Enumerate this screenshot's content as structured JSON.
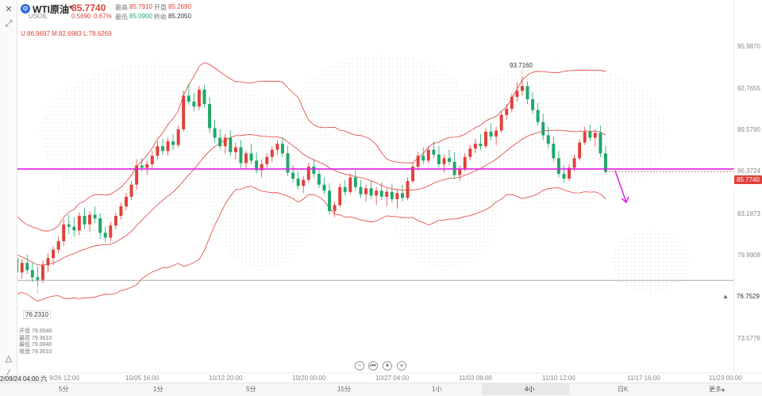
{
  "header": {
    "logo_letter": "◉",
    "symbol": "WTI原油",
    "ticker": "USOIL",
    "price": "85.7740",
    "change": "0.5690",
    "change_pct": "0.67%",
    "high_label": "最高",
    "high": "85.7910",
    "open_label": "开盘",
    "open": "85.2690",
    "low_label": "最低",
    "low": "85.0900",
    "prev_label": "昨收",
    "prev": "85.2050",
    "bollinger": "U:86.9697  M:82.6983  L:78.6269"
  },
  "colors": {
    "up": "#e0413a",
    "down": "#1fa76a",
    "band": "#e0413a",
    "hline": "#e020e0",
    "arrow": "#e020e0"
  },
  "y_axis": {
    "ticks": [
      "95.9870",
      "92.7655",
      "89.5790",
      "86.3724",
      "83.1873",
      "79.9908",
      "73.5776"
    ]
  },
  "price_tags": {
    "current": "85.7740",
    "low_line": "76.7529"
  },
  "annotations": {
    "peak": "93.7160",
    "trough": "76.2310"
  },
  "crosshair_info": {
    "lines": [
      "开盘 79.0040",
      "最高 79.3610",
      "最低 79.0040",
      "收盘 79.3010"
    ]
  },
  "x_axis": {
    "cursor": "2/09/24 04:00 六",
    "labels": [
      "9/26 12:00",
      "10/05 16:00",
      "10/12 20:00",
      "10/20 00:00",
      "10/27 04:00",
      "11/03 08:00",
      "11/10 12:00",
      "11/17 16:00",
      "11/23 00:00"
    ]
  },
  "timeframes": [
    "5分",
    "1分",
    "5分",
    "15分",
    "1小时",
    "4小时",
    "日K",
    "更多"
  ],
  "timeframes_display": [
    "5分",
    "1分",
    "5分",
    "15分",
    "1小",
    "4小",
    "日K",
    "更多▴"
  ],
  "chart_data": {
    "type": "candlestick",
    "title": "WTI原油",
    "ylim": [
      70.5,
      98.2
    ],
    "candles": [
      [
        79.5,
        81.2,
        78.8,
        80.6
      ],
      [
        80.6,
        81.0,
        78.0,
        78.6
      ],
      [
        78.6,
        79.3,
        77.0,
        77.4
      ],
      [
        77.4,
        78.5,
        76.9,
        78.2
      ],
      [
        78.2,
        78.9,
        77.3,
        77.6
      ],
      [
        77.6,
        78.3,
        76.6,
        77.0
      ],
      [
        77.0,
        77.9,
        76.2,
        76.8
      ],
      [
        76.8,
        78.4,
        76.5,
        78.0
      ],
      [
        78.0,
        79.0,
        77.4,
        78.6
      ],
      [
        78.6,
        79.6,
        78.0,
        79.3
      ],
      [
        79.3,
        80.4,
        79.0,
        80.0
      ],
      [
        80.0,
        81.8,
        79.6,
        81.4
      ],
      [
        81.4,
        82.2,
        80.6,
        81.2
      ],
      [
        81.2,
        82.0,
        80.4,
        80.9
      ],
      [
        80.9,
        82.4,
        80.5,
        82.1
      ],
      [
        82.1,
        82.8,
        81.0,
        81.4
      ],
      [
        81.4,
        82.5,
        80.8,
        82.2
      ],
      [
        82.2,
        82.9,
        81.5,
        81.9
      ],
      [
        81.9,
        82.3,
        80.2,
        80.7
      ],
      [
        80.7,
        81.2,
        79.9,
        80.3
      ],
      [
        80.3,
        81.6,
        80.0,
        81.3
      ],
      [
        81.3,
        82.4,
        81.0,
        82.1
      ],
      [
        82.1,
        83.2,
        81.8,
        82.9
      ],
      [
        82.9,
        84.0,
        82.6,
        83.7
      ],
      [
        83.7,
        85.0,
        83.4,
        84.7
      ],
      [
        84.7,
        86.8,
        84.3,
        86.3
      ],
      [
        86.3,
        86.9,
        85.8,
        86.1
      ],
      [
        86.1,
        86.7,
        85.5,
        86.4
      ],
      [
        86.4,
        87.5,
        86.0,
        87.1
      ],
      [
        87.1,
        88.3,
        86.8,
        87.9
      ],
      [
        87.9,
        88.5,
        87.2,
        87.5
      ],
      [
        87.5,
        88.6,
        87.1,
        88.3
      ],
      [
        88.3,
        88.9,
        87.6,
        88.0
      ],
      [
        88.0,
        89.6,
        87.8,
        89.3
      ],
      [
        89.3,
        92.5,
        89.1,
        92.1
      ],
      [
        92.1,
        93.1,
        91.3,
        91.6
      ],
      [
        91.6,
        92.3,
        90.8,
        91.2
      ],
      [
        91.2,
        92.9,
        90.9,
        92.6
      ],
      [
        92.6,
        93.0,
        91.1,
        91.4
      ],
      [
        91.4,
        92.0,
        89.0,
        89.4
      ],
      [
        89.4,
        90.1,
        88.2,
        88.6
      ],
      [
        88.6,
        89.3,
        87.6,
        87.9
      ],
      [
        87.9,
        88.9,
        87.3,
        88.6
      ],
      [
        88.6,
        89.2,
        87.1,
        87.4
      ],
      [
        87.4,
        88.2,
        86.8,
        87.8
      ],
      [
        87.8,
        88.4,
        86.1,
        86.5
      ],
      [
        86.5,
        87.5,
        86.0,
        87.3
      ],
      [
        87.3,
        88.1,
        86.4,
        86.7
      ],
      [
        86.7,
        87.4,
        85.6,
        85.9
      ],
      [
        85.9,
        86.8,
        85.3,
        86.4
      ],
      [
        86.4,
        87.3,
        86.1,
        87.0
      ],
      [
        87.0,
        87.9,
        86.6,
        87.6
      ],
      [
        87.6,
        88.4,
        87.2,
        88.1
      ],
      [
        88.1,
        88.6,
        87.0,
        87.3
      ],
      [
        87.3,
        87.9,
        85.4,
        85.7
      ],
      [
        85.7,
        86.3,
        84.9,
        85.2
      ],
      [
        85.2,
        85.8,
        84.3,
        84.6
      ],
      [
        84.6,
        85.4,
        84.0,
        85.1
      ],
      [
        85.1,
        86.5,
        84.9,
        86.2
      ],
      [
        86.2,
        86.8,
        85.3,
        85.6
      ],
      [
        85.6,
        86.0,
        84.4,
        84.7
      ],
      [
        84.7,
        85.3,
        83.9,
        84.2
      ],
      [
        84.2,
        84.8,
        82.2,
        82.5
      ],
      [
        82.5,
        83.3,
        82.0,
        83.0
      ],
      [
        83.0,
        84.8,
        82.8,
        84.5
      ],
      [
        84.5,
        85.1,
        83.8,
        84.1
      ],
      [
        84.1,
        85.6,
        83.9,
        85.3
      ],
      [
        85.3,
        85.9,
        84.2,
        84.5
      ],
      [
        84.5,
        85.1,
        83.6,
        83.9
      ],
      [
        83.9,
        84.7,
        83.3,
        84.4
      ],
      [
        84.4,
        85.0,
        83.5,
        83.8
      ],
      [
        83.8,
        84.5,
        83.0,
        84.2
      ],
      [
        84.2,
        84.9,
        83.4,
        83.7
      ],
      [
        83.7,
        84.4,
        82.9,
        84.1
      ],
      [
        84.1,
        84.8,
        83.2,
        83.5
      ],
      [
        83.5,
        84.3,
        82.7,
        84.0
      ],
      [
        84.0,
        84.7,
        83.3,
        83.6
      ],
      [
        83.6,
        85.3,
        83.4,
        85.0
      ],
      [
        85.0,
        86.5,
        84.8,
        86.2
      ],
      [
        86.2,
        87.4,
        85.9,
        87.1
      ],
      [
        87.1,
        87.8,
        86.4,
        86.7
      ],
      [
        86.7,
        87.9,
        86.5,
        87.6
      ],
      [
        87.6,
        88.3,
        86.9,
        87.2
      ],
      [
        87.2,
        87.9,
        86.1,
        86.4
      ],
      [
        86.4,
        87.2,
        85.7,
        86.9
      ],
      [
        86.9,
        87.6,
        86.3,
        86.6
      ],
      [
        86.6,
        87.4,
        85.2,
        85.5
      ],
      [
        85.5,
        86.3,
        85.0,
        86.0
      ],
      [
        86.0,
        87.3,
        85.8,
        87.0
      ],
      [
        87.0,
        88.0,
        86.7,
        87.7
      ],
      [
        87.7,
        88.5,
        87.3,
        88.1
      ],
      [
        88.1,
        88.9,
        87.6,
        87.9
      ],
      [
        87.9,
        89.4,
        87.7,
        89.1
      ],
      [
        89.1,
        89.8,
        88.4,
        88.7
      ],
      [
        88.7,
        89.5,
        88.0,
        89.2
      ],
      [
        89.2,
        90.8,
        89.0,
        90.5
      ],
      [
        90.5,
        91.4,
        90.1,
        91.0
      ],
      [
        91.0,
        92.3,
        90.7,
        92.0
      ],
      [
        92.0,
        93.2,
        91.6,
        92.5
      ],
      [
        92.5,
        93.7,
        92.1,
        92.9
      ],
      [
        92.9,
        93.3,
        91.4,
        91.8
      ],
      [
        91.8,
        92.4,
        90.6,
        90.9
      ],
      [
        90.9,
        91.5,
        89.6,
        89.9
      ],
      [
        89.9,
        90.6,
        88.4,
        88.8
      ],
      [
        88.8,
        89.5,
        87.7,
        88.1
      ],
      [
        88.1,
        88.7,
        86.6,
        86.9
      ],
      [
        86.9,
        87.5,
        85.3,
        85.6
      ],
      [
        85.6,
        86.3,
        84.9,
        85.2
      ],
      [
        85.2,
        86.4,
        85.0,
        86.1
      ],
      [
        86.1,
        87.2,
        85.8,
        86.9
      ],
      [
        86.9,
        88.5,
        86.7,
        88.2
      ],
      [
        88.2,
        89.5,
        88.0,
        89.1
      ],
      [
        89.1,
        89.7,
        88.3,
        88.6
      ],
      [
        88.6,
        89.3,
        87.9,
        89.0
      ],
      [
        89.0,
        89.6,
        87.0,
        87.3
      ],
      [
        87.3,
        87.9,
        85.6,
        85.77
      ]
    ],
    "bollinger": {
      "upper_label": "U",
      "middle_label": "M",
      "lower_label": "L",
      "upper_value": 86.9697,
      "middle_value": 82.6983,
      "lower_value": 78.6269
    },
    "hline_magenta": 86.0,
    "hline_gray": 76.7529,
    "peak_value": 93.716,
    "trough_value": 76.231
  }
}
